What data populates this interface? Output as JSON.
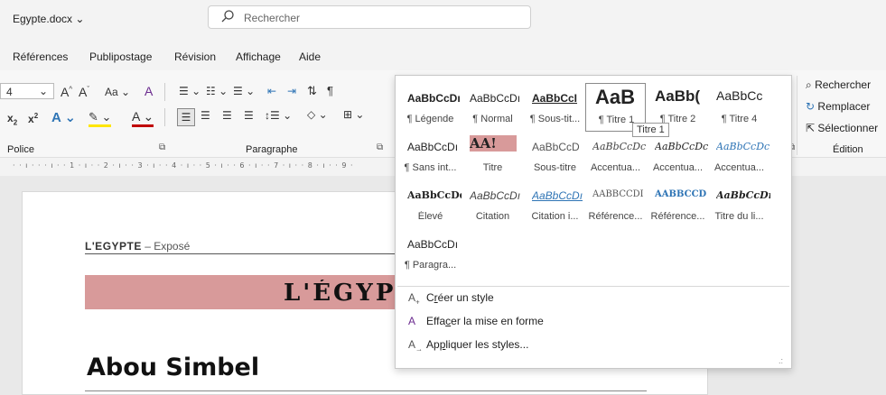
{
  "titlebar": {
    "filename": "Egypte.docx",
    "search_placeholder": "Rechercher"
  },
  "menu": [
    "Références",
    "Publipostage",
    "Révision",
    "Affichage",
    "Aide"
  ],
  "ribbon": {
    "font_size": "4",
    "grow_font": "A^",
    "shrink_font": "Aˇ",
    "change_case": "Aa",
    "groups": {
      "police": "Police",
      "paragraphe": "Paragraphe",
      "edition": "Édition"
    },
    "editing": {
      "find": "Rechercher",
      "replace": "Remplacer",
      "select": "Sélectionner"
    }
  },
  "ruler": "· · ı · · · ı · · 1 · ı · · 2 · ı · · 3 · ı · · 4 · ı · · 5 · ı · · 6 · ı · · 7 · ı · · 8 · ı · · 9 ·",
  "document": {
    "header_title_bold": "L'EGYPTE",
    "header_title_rest": " – Exposé",
    "banner": "L'ÉGYPTE",
    "heading": "Abou Simbel"
  },
  "gallery": {
    "styles": [
      {
        "preview": "AaBbCcDı",
        "label": "¶ Légende"
      },
      {
        "preview": "AaBbCcDı",
        "label": "¶ Normal"
      },
      {
        "preview": "AaBbCcI",
        "label": "¶ Sous-tit..."
      },
      {
        "preview": "AaB",
        "label": "¶ Titre 1"
      },
      {
        "preview": "AaBb(",
        "label": "¶ Titre 2"
      },
      {
        "preview": "AaBbCc",
        "label": "¶ Titre 4"
      },
      {
        "preview": "AaBbCcDı",
        "label": "¶ Sans int..."
      },
      {
        "preview": "AA!",
        "label": "Titre"
      },
      {
        "preview": "AaBbCcD",
        "label": "Sous-titre"
      },
      {
        "preview": "AaBbCcDc",
        "label": "Accentua..."
      },
      {
        "preview": "AaBbCcDc",
        "label": "Accentua..."
      },
      {
        "preview": "AaBbCcDc",
        "label": "Accentua..."
      },
      {
        "preview": "AaBbCcDd",
        "label": "Élevé"
      },
      {
        "preview": "AaBbCcDı",
        "label": "Citation"
      },
      {
        "preview": "AaBbCcDı",
        "label": "Citation i..."
      },
      {
        "preview": "AABBCCDI",
        "label": "Référence..."
      },
      {
        "preview": "AABBCCD",
        "label": "Référence..."
      },
      {
        "preview": "AaBbCcDı",
        "label": "Titre du li..."
      },
      {
        "preview": "AaBbCcDı",
        "label": "¶ Paragra..."
      }
    ],
    "tooltip": "Titre 1",
    "actions": [
      {
        "pre": "C",
        "key": "r",
        "post": "éer un style"
      },
      {
        "pre": "Effa",
        "key": "c",
        "post": "er la mise en forme"
      },
      {
        "pre": "Ap",
        "key": "p",
        "post": "liquer les styles..."
      }
    ]
  },
  "colors": {
    "banner_bg": "#d89a9a",
    "title_preview": "#1f3864",
    "accent_blue": "#2e74b5"
  }
}
